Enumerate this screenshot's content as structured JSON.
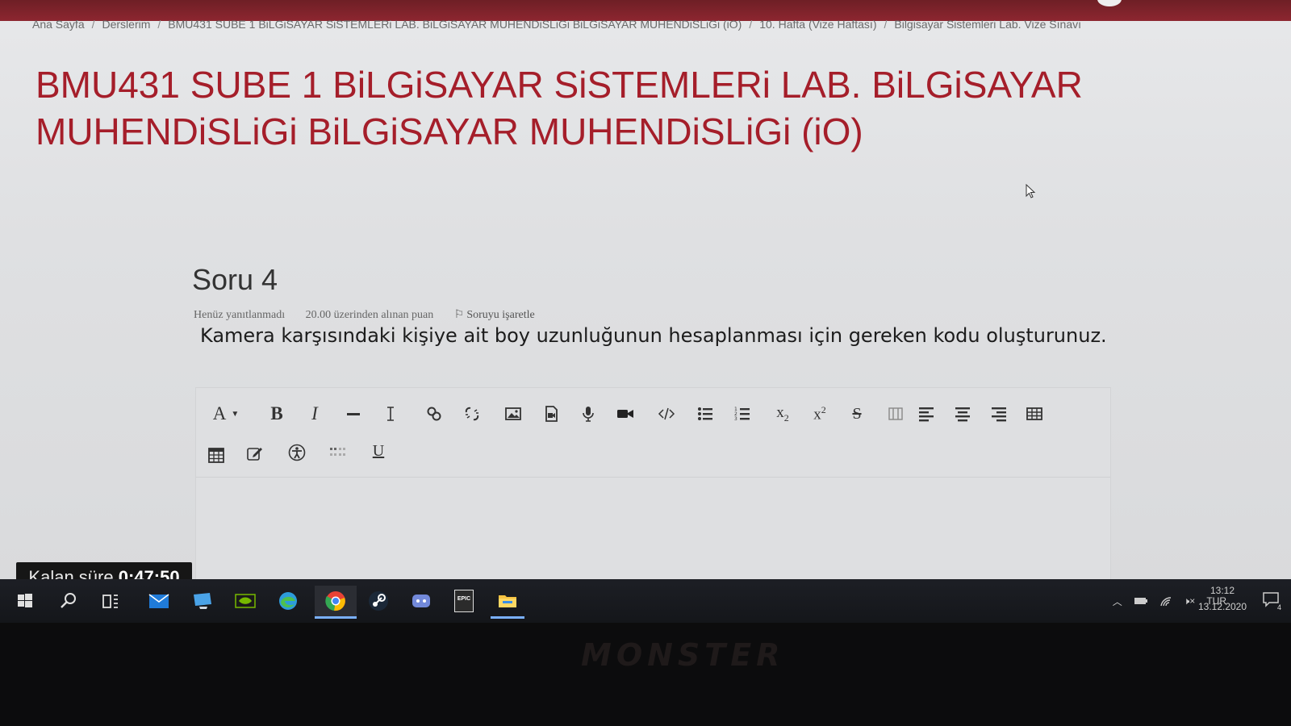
{
  "breadcrumb": {
    "items": [
      "Ana Sayfa",
      "Derslerim",
      "BMU431 SUBE 1 BiLGiSAYAR SiSTEMLERi LAB. BiLGiSAYAR MUHENDiSLiGi BiLGiSAYAR MUHENDiSLiGi (iO)",
      "10. Hafta (Vize Haftası)",
      "Bilgisayar Sistemleri Lab. Vize Sınavı"
    ],
    "separator": "/"
  },
  "page_title": "BMU431 SUBE 1 BiLGiSAYAR SiSTEMLERi LAB. BiLGiSAYAR MUHENDiSLiGi BiLGiSAYAR MUHENDiSLiGi (iO)",
  "question": {
    "heading": "Soru 4",
    "status": "Henüz yanıtlanmadı",
    "points": "20.00 üzerinden alınan puan",
    "flag_label": "Soruyu işaretle",
    "text": "Kamera karşısındaki kişiye ait boy uzunluğunun hesaplanması için gereken kodu oluşturunuz."
  },
  "editor": {
    "toolbar_row1": [
      "font-color",
      "bold",
      "italic",
      "horizontal-rule",
      "clear-format",
      "link",
      "unlink",
      "image",
      "media",
      "record-audio",
      "record-video",
      "html",
      "unordered-list",
      "ordered-list",
      "subscript",
      "superscript",
      "strikethrough",
      "rtl-ltr",
      "align-left",
      "align-center",
      "align-right",
      "table"
    ],
    "toolbar_row2": [
      "equation",
      "edit",
      "accessibility",
      "special-chars",
      "underline"
    ],
    "bold_glyph": "B",
    "italic_glyph": "I",
    "underline_glyph": "U",
    "font_glyph": "A"
  },
  "timer": {
    "label": "Kalan süre",
    "value": "0:47:50"
  },
  "taskbar": {
    "apps": [
      "windows-start",
      "search",
      "task-view",
      "mail",
      "desktop",
      "nvidia",
      "edge",
      "chrome",
      "steam",
      "discord",
      "epic-games",
      "file-explorer"
    ],
    "epic_label": "EPIC",
    "language": "TUR",
    "time": "13:12",
    "date": "13.12.2020",
    "notification_count": "4"
  },
  "bezel_brand": "MONSTER",
  "colors": {
    "top_bar": "#8d2630",
    "title_red": "#a51e2a",
    "page_bg": "#e3e4e6",
    "taskbar_bg": "#1a1c21"
  }
}
